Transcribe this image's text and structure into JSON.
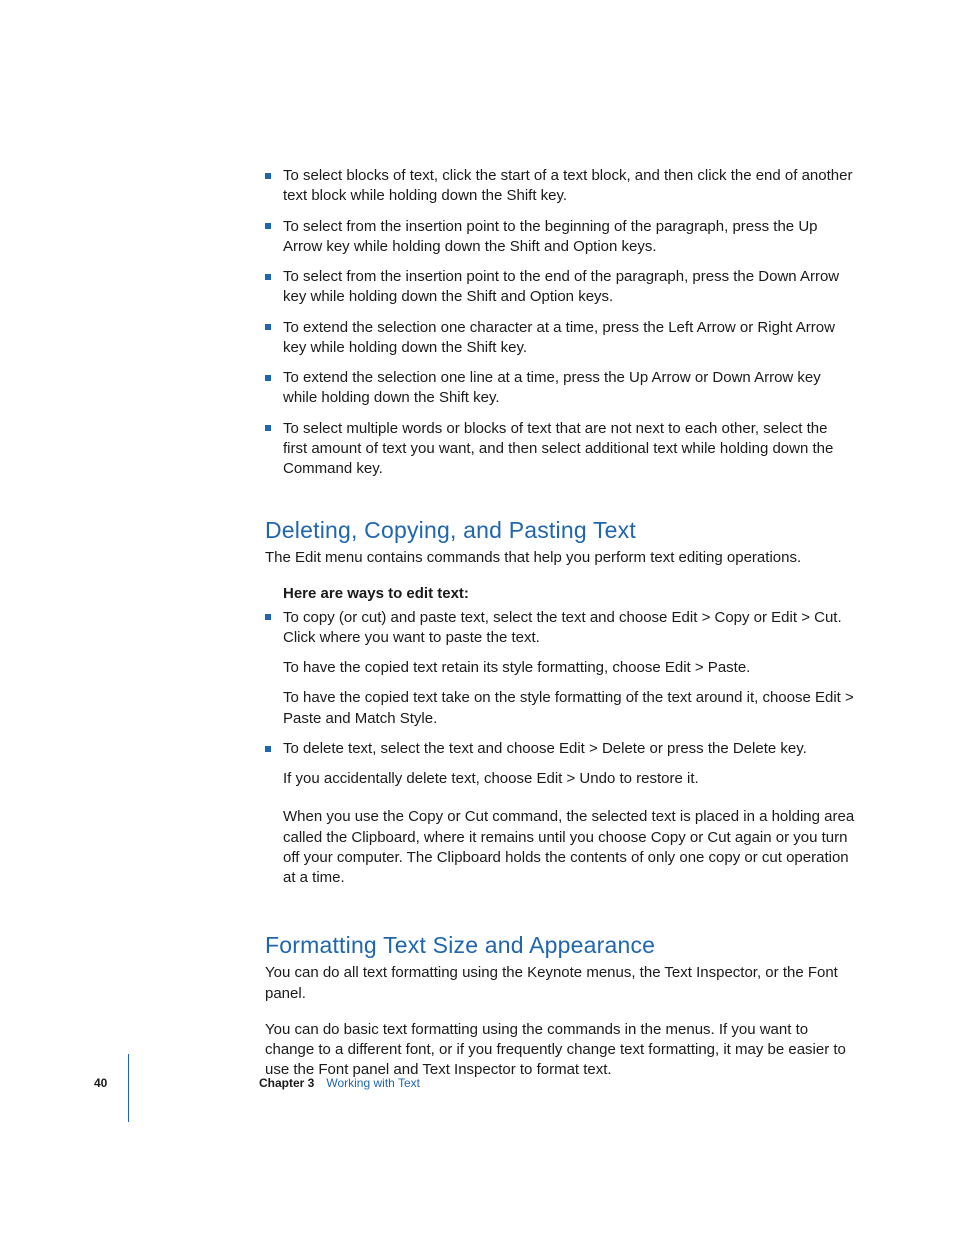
{
  "top_bullets": [
    "To select blocks of text, click the start of a text block, and then click the end of another text block while holding down the Shift key.",
    "To select from the insertion point to the beginning of the paragraph, press the Up Arrow key while holding down the Shift and Option keys.",
    "To select from the insertion point to the end of the paragraph, press the Down Arrow key while holding down the Shift and Option keys.",
    "To extend the selection one character at a time, press the Left Arrow or Right Arrow key while holding down the Shift key.",
    "To extend the selection one line at a time, press the Up Arrow or Down Arrow key while holding down the Shift key.",
    "To select multiple words or blocks of text that are not next to each other, select the first amount of text you want, and then select additional text while holding down the Command key."
  ],
  "section1": {
    "heading": "Deleting, Copying, and Pasting Text",
    "intro": "The Edit menu contains commands that help you perform text editing operations.",
    "lead": "Here are ways to edit text:",
    "items": [
      {
        "main": "To copy (or cut) and paste text, select the text and choose Edit > Copy or Edit > Cut. Click where you want to paste the text.",
        "para1": "To have the copied text retain its style formatting, choose Edit > Paste.",
        "para2": "To have the copied text take on the style formatting of the text around it, choose Edit > Paste and Match Style."
      },
      {
        "main": "To delete text, select the text and choose Edit > Delete or press the Delete key.",
        "para1": "If you accidentally delete text, choose Edit > Undo to restore it."
      }
    ],
    "closing": "When you use the Copy or Cut command, the selected text is placed in a holding area called the Clipboard, where it remains until you choose Copy or Cut again or you turn off your computer. The Clipboard holds the contents of only one copy or cut operation at a time."
  },
  "section2": {
    "heading": "Formatting Text Size and Appearance",
    "p1": "You can do all text formatting using the Keynote menus, the Text Inspector, or the Font panel.",
    "p2": "You can do basic text formatting using the commands in the menus. If you want to change to a different font, or if you frequently change text formatting, it may be easier to use the Font panel and Text Inspector to format text."
  },
  "footer": {
    "page": "40",
    "chapter_label": "Chapter 3",
    "chapter_title": "Working with Text"
  }
}
